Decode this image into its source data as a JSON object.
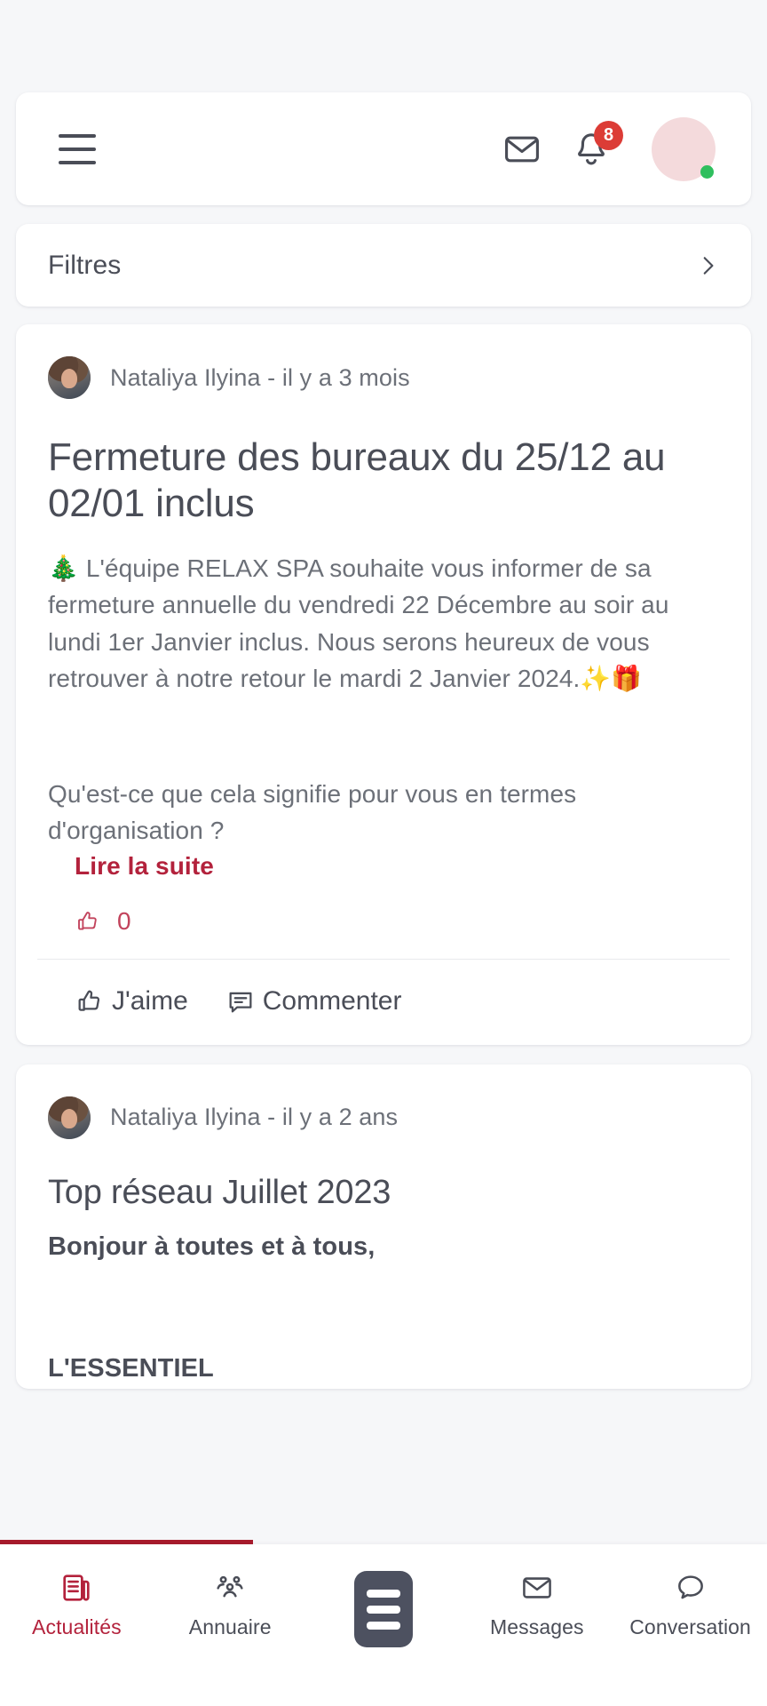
{
  "header": {
    "menu_icon": "hamburger-menu-icon",
    "mail_icon": "envelope-icon",
    "bell_icon": "bell-icon",
    "notification_count": "8",
    "avatar_icon": "user-avatar",
    "status": "online"
  },
  "filters": {
    "label": "Filtres",
    "chevron_icon": "chevron-right-icon"
  },
  "posts": [
    {
      "author": "Nataliya Ilyina - il y a 3 mois",
      "title": "Fermeture des bureaux du 25/12 au 02/01 inclus",
      "body_line1": "🎄 L'équipe RELAX SPA souhaite vous informer de sa fermeture annuelle du vendredi 22 Décembre au soir au lundi 1er Janvier inclus. Nous serons heureux de vous retrouver à notre retour le mardi 2 Janvier 2024.✨🎁",
      "body_line2": "Qu'est-ce que cela signifie pour vous en termes d'organisation ?",
      "read_more": "Lire la suite",
      "like_count": "0",
      "like_icon": "thumbs-up-icon",
      "like_label": "J'aime",
      "comment_icon": "comment-bubble-icon",
      "comment_label": "Commenter"
    },
    {
      "author": "Nataliya Ilyina - il y a 2 ans",
      "title": "Top réseau Juillet 2023",
      "greeting": "Bonjour à toutes et à tous,",
      "section_heading": "L'ESSENTIEL"
    }
  ],
  "bottom_nav": {
    "items": [
      {
        "label": "Actualités",
        "icon": "news-document-icon",
        "active": true
      },
      {
        "label": "Annuaire",
        "icon": "people-group-icon",
        "active": false
      },
      {
        "label": "",
        "icon": "menu-list-button-icon",
        "active": false
      },
      {
        "label": "Messages",
        "icon": "envelope-icon",
        "active": false
      },
      {
        "label": "Conversation",
        "icon": "chat-bubble-icon",
        "active": false
      }
    ]
  },
  "colors": {
    "accent_red": "#b3223c",
    "badge_red": "#dc3c36",
    "progress_red": "#a81b2c",
    "text_primary": "#4a4d57",
    "text_secondary": "#6c7078",
    "page_bg": "#f6f7f9",
    "card_bg": "#ffffff",
    "online_green": "#2fbf5e"
  }
}
